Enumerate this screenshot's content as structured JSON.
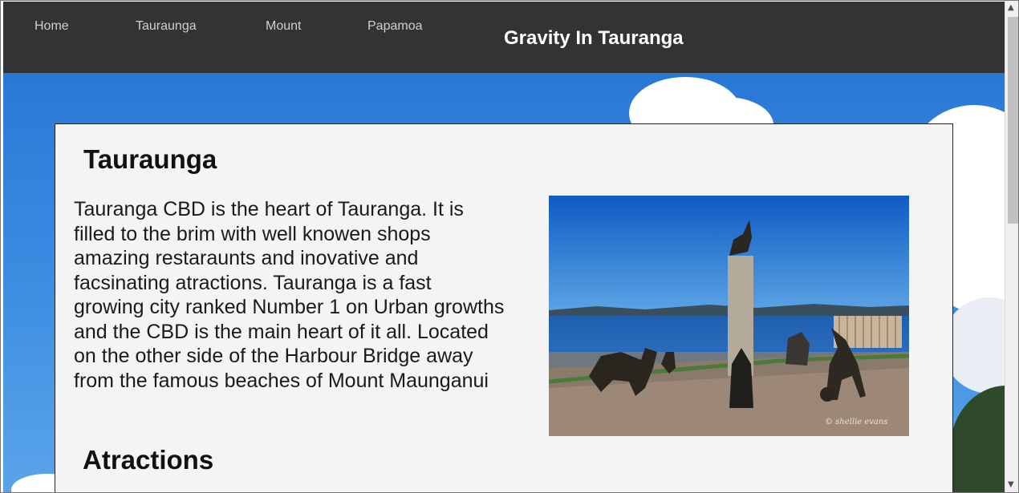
{
  "nav": {
    "links": [
      {
        "label": "Home"
      },
      {
        "label": "Tauraunga"
      },
      {
        "label": "Mount"
      },
      {
        "label": "Papamoa"
      }
    ],
    "site_title": "Gravity In Tauranga"
  },
  "content": {
    "heading": "Tauraunga",
    "paragraph": "Tauranga CBD is the heart of Tauranga. It is filled to the brim with well knowen shops amazing restaraunts and inovative and facsinating atractions. Tauranga is a fast growing city ranked Number 1 on Urban growths and the CBD is the main heart of it all. Located on the other side of the Harbour Bridge away from the famous beaches of Mount Maunganui",
    "subheading": "Atractions",
    "photo": {
      "watermark": "© shellie evans"
    }
  },
  "colors": {
    "navbar_bg": "#333333",
    "nav_link": "#cfcfcf",
    "card_bg": "#f4f4f4",
    "sky": "#2a78d6"
  },
  "scrollbar": {
    "up_icon": "triangle-up-icon",
    "down_icon": "triangle-down-icon"
  }
}
